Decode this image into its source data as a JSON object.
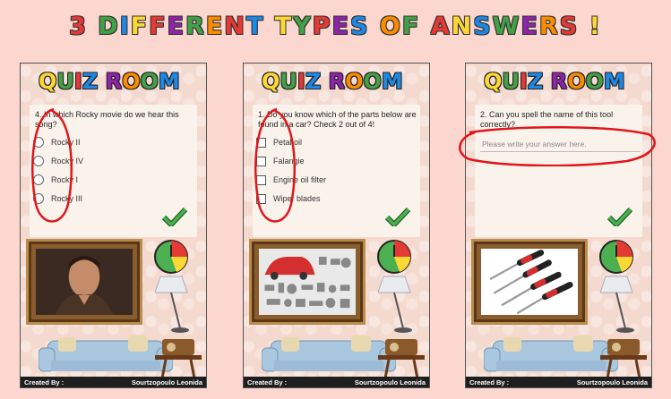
{
  "headline": {
    "letters": [
      {
        "ch": "3",
        "color": "#e53935"
      },
      {
        "ch": " ",
        "color": "#000"
      },
      {
        "ch": "D",
        "color": "#43a047"
      },
      {
        "ch": "I",
        "color": "#1e88e5"
      },
      {
        "ch": "F",
        "color": "#fdd835"
      },
      {
        "ch": "F",
        "color": "#e53935"
      },
      {
        "ch": "E",
        "color": "#8e24aa"
      },
      {
        "ch": "R",
        "color": "#43a047"
      },
      {
        "ch": "E",
        "color": "#fb8c00"
      },
      {
        "ch": "N",
        "color": "#e53935"
      },
      {
        "ch": "T",
        "color": "#1e88e5"
      },
      {
        "ch": " ",
        "color": "#000"
      },
      {
        "ch": "T",
        "color": "#fdd835"
      },
      {
        "ch": "Y",
        "color": "#43a047"
      },
      {
        "ch": "P",
        "color": "#e53935"
      },
      {
        "ch": "E",
        "color": "#8e24aa"
      },
      {
        "ch": "S",
        "color": "#1e88e5"
      },
      {
        "ch": " ",
        "color": "#000"
      },
      {
        "ch": "O",
        "color": "#fb8c00"
      },
      {
        "ch": "F",
        "color": "#43a047"
      },
      {
        "ch": " ",
        "color": "#000"
      },
      {
        "ch": "A",
        "color": "#e53935"
      },
      {
        "ch": "N",
        "color": "#fdd835"
      },
      {
        "ch": "S",
        "color": "#1e88e5"
      },
      {
        "ch": "W",
        "color": "#43a047"
      },
      {
        "ch": "E",
        "color": "#8e24aa"
      },
      {
        "ch": "R",
        "color": "#fb8c00"
      },
      {
        "ch": "S",
        "color": "#e53935"
      },
      {
        "ch": " ",
        "color": "#000"
      },
      {
        "ch": "!",
        "color": "#fdd835"
      }
    ]
  },
  "logo": {
    "letters": [
      {
        "ch": "Q",
        "color": "#fdd835"
      },
      {
        "ch": "U",
        "color": "#43a047"
      },
      {
        "ch": "I",
        "color": "#e53935"
      },
      {
        "ch": "Z",
        "color": "#1e88e5"
      },
      {
        "ch": " ",
        "color": "#000"
      },
      {
        "ch": "R",
        "color": "#8e24aa"
      },
      {
        "ch": "O",
        "color": "#fb8c00"
      },
      {
        "ch": "O",
        "color": "#43a047"
      },
      {
        "ch": "M",
        "color": "#1e88e5"
      }
    ]
  },
  "colors": {
    "annotation": "#e0161b",
    "check": "#2e9e2e",
    "footer_bg": "#1e1e1e"
  },
  "phones": [
    {
      "question": "4. In which Rocky movie do we hear this song?",
      "input_type": "radio",
      "options": [
        "Rocky II",
        "Rocky IV",
        "Rocky I",
        "Rocky III"
      ],
      "image_icon": "rocky-portrait"
    },
    {
      "question": "1. Do you know which of the parts below are found in a car? Check 2 out of 4!",
      "input_type": "checkbox",
      "options": [
        "Petal oil",
        "Falangie",
        "Engine oil filter",
        "Wiper blades"
      ],
      "image_icon": "car-parts"
    },
    {
      "question": "2. Can you spell the name of this tool correctly?",
      "input_type": "text",
      "placeholder": "Please write your answer here.",
      "image_icon": "screwdrivers"
    }
  ],
  "footer": {
    "left": "Created By :",
    "right": "Sourtzopoulo Leonida"
  }
}
